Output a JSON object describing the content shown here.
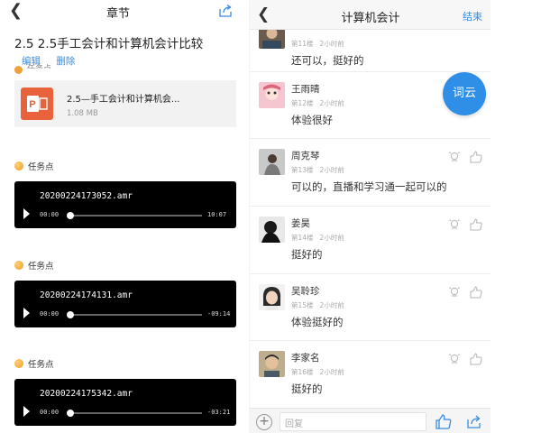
{
  "left": {
    "header": {
      "title": "章节"
    },
    "page_title": "2.5 2.5手工会计和计算机会计比较",
    "actions": {
      "edit": "编辑",
      "delete": "删除"
    },
    "cut_label": "任务点",
    "file": {
      "name": "2.5—手工会计和计算机会...",
      "size": "1.08 MB"
    },
    "tasks": [
      {
        "label": "任务点",
        "file": "20200224173052.amr",
        "start": "00:00",
        "end": "10:07"
      },
      {
        "label": "任务点",
        "file": "20200224174131.amr",
        "start": "00:00",
        "end": "-09:14"
      },
      {
        "label": "任务点",
        "file": "20200224175342.amr",
        "start": "00:00",
        "end": "-03:21"
      }
    ]
  },
  "right": {
    "header": {
      "title": "计算机会计",
      "end_label": "结束"
    },
    "word_cloud": "词云",
    "comments": [
      {
        "name": "",
        "floor": "第11楼",
        "time": "2小时前",
        "text": "还可以，挺好的"
      },
      {
        "name": "王雨晴",
        "floor": "第12楼",
        "time": "2小时前",
        "text": "体验很好"
      },
      {
        "name": "周克琴",
        "floor": "第13楼",
        "time": "2小时前",
        "text": "可以的，直播和学习通一起可以的"
      },
      {
        "name": "姜昊",
        "floor": "第14楼",
        "time": "2小时前",
        "text": "挺好的"
      },
      {
        "name": "吴聆珍",
        "floor": "第15楼",
        "time": "2小时前",
        "text": "体验挺好的"
      },
      {
        "name": "李家名",
        "floor": "第16楼",
        "time": "2小时前",
        "text": "挺好的"
      }
    ],
    "reply": {
      "placeholder": "回复"
    }
  },
  "colors": {
    "accent": "#3a8be0",
    "wordcloud": "#2f8fe6",
    "task_dot": "#f29a1c",
    "ppt": "#e8633b"
  }
}
